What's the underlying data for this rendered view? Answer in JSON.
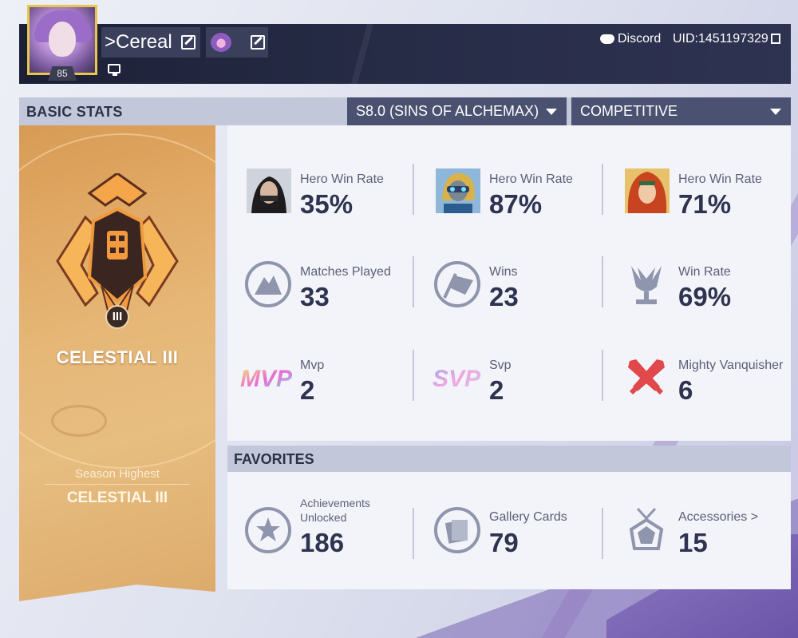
{
  "header": {
    "level": "85",
    "player_name": ">Cereal",
    "discord_label": "Discord",
    "uid": "UID:1451197329"
  },
  "basic_stats": {
    "title": "BASIC STATS",
    "season_dropdown": "S8.0 (SINS OF ALCHEMAX)",
    "mode_dropdown": "COMPETITIVE"
  },
  "rank": {
    "current": "CELESTIAL III",
    "numeral": "III",
    "season_highest_label": "Season Highest",
    "season_highest_value": "CELESTIAL III"
  },
  "stats": [
    {
      "label": "Hero Win Rate",
      "value": "35%",
      "icon": "hero-winter-soldier"
    },
    {
      "label": "Hero Win Rate",
      "value": "87%",
      "icon": "hero-star-lord"
    },
    {
      "label": "Hero Win Rate",
      "value": "71%",
      "icon": "hero-jean-grey"
    },
    {
      "label": "Matches Played",
      "value": "33",
      "icon": "matches-played-icon"
    },
    {
      "label": "Wins",
      "value": "23",
      "icon": "wins-flag-icon"
    },
    {
      "label": "Win Rate",
      "value": "69%",
      "icon": "win-rate-trophy-icon"
    },
    {
      "label": "Mvp",
      "value": "2",
      "icon": "mvp-icon"
    },
    {
      "label": "Svp",
      "value": "2",
      "icon": "svp-icon"
    },
    {
      "label": "Mighty Vanquisher",
      "value": "6",
      "icon": "crossed-swords-icon"
    }
  ],
  "favorites": {
    "title": "FAVORITES",
    "items": [
      {
        "label_line1": "Achievements",
        "label_line2": "Unlocked",
        "value": "186"
      },
      {
        "label": "Gallery Cards",
        "value": "79"
      },
      {
        "label": "Accessories >",
        "value": "15"
      }
    ]
  },
  "colors": {
    "header_bg": "#1c2036",
    "bar_bg": "#c3c7da",
    "dropdown_bg": "#4b5170",
    "panel_bg": "#f3f4f9",
    "rank_gold": "#e0a762",
    "accent_red": "#e0484b"
  }
}
